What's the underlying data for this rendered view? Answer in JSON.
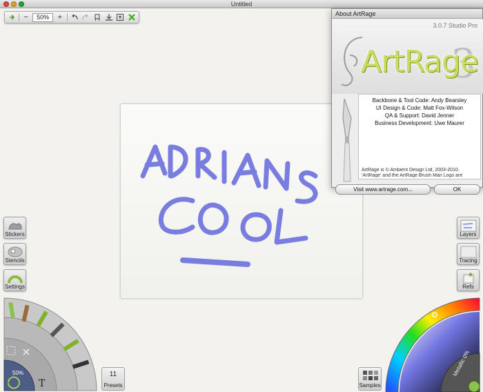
{
  "window": {
    "title": "Untitled"
  },
  "toolbar": {
    "zoom_value": "50%",
    "minus_label": "−",
    "plus_label": "+"
  },
  "canvas": {
    "text_line1": "ADRIANS",
    "text_line2": "COOL",
    "stroke_color": "#6f73de"
  },
  "about": {
    "title": "About ArtRage",
    "version": "3.0.7 Studio Pro",
    "logo_text": "ArtRage",
    "logo_number": "3",
    "credits": [
      "Backbone & Tool Code: Andy Bearsley",
      "UI Design & Code: Matt Fox-Wilson",
      "QA & Support: David Jenner",
      "Business Development: Uwe Maurer"
    ],
    "copyright": "ArtRage is © Ambient Design Ltd, 2003-2010. 'ArtRage' and the ArtRage Brush Man Logo are",
    "visit_button": "Visit www.artrage.com...",
    "ok_button": "OK"
  },
  "left_panel": {
    "stickers": "Stickers",
    "stencils": "Stencils",
    "settings": "Settings"
  },
  "right_panel": {
    "layers": "Layers",
    "tracing": "Tracing",
    "refs": "Refs"
  },
  "tool_wheel": {
    "zoom_label": "50%",
    "text_tool": "T"
  },
  "presets": {
    "count": "11",
    "label": "Presets"
  },
  "samples": {
    "label": "Samples"
  },
  "color_picker": {
    "metallic_label": "Metallic 0%",
    "accent": "#6f73de"
  }
}
